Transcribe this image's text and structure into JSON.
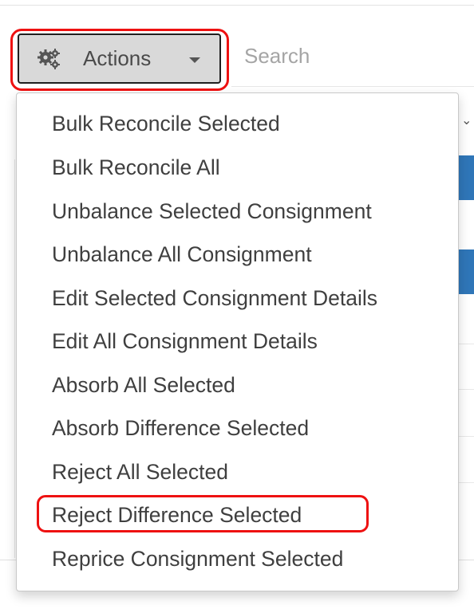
{
  "toolbar": {
    "actions_label": "Actions",
    "actions_icon": "gears-icon",
    "search_placeholder": "Search"
  },
  "actions_menu": {
    "items": [
      {
        "label": "Bulk Reconcile Selected"
      },
      {
        "label": "Bulk Reconcile All"
      },
      {
        "label": "Unbalance Selected Consignment"
      },
      {
        "label": "Unbalance All Consignment"
      },
      {
        "label": "Edit Selected Consignment Details"
      },
      {
        "label": "Edit All Consignment Details"
      },
      {
        "label": "Absorb All Selected"
      },
      {
        "label": "Absorb Difference Selected"
      },
      {
        "label": "Reject All Selected"
      },
      {
        "label": "Reject Difference Selected",
        "highlighted": true
      },
      {
        "label": "Reprice Consignment Selected"
      }
    ]
  },
  "colors": {
    "highlight": "#ee1111",
    "button_bg": "#d9d9d9",
    "row_selected": "#2f76b8"
  }
}
